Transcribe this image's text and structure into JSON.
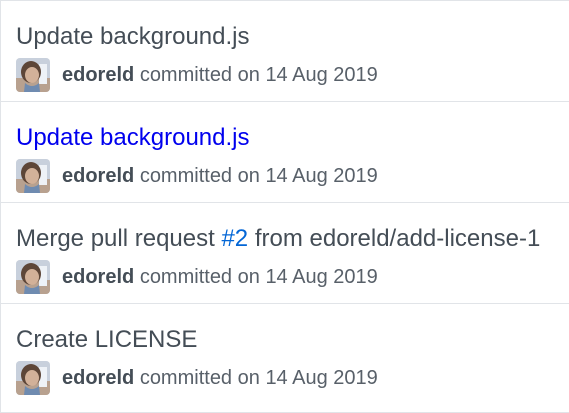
{
  "commits": [
    {
      "title": "Update background.js",
      "author": "edoreld",
      "action": "committed on",
      "date": "14 Aug 2019"
    },
    {
      "title": "Update background.js",
      "author": "edoreld",
      "action": "committed on",
      "date": "14 Aug 2019"
    },
    {
      "title_prefix": "Merge pull request",
      "pr_number": "#2",
      "title_suffix": "from edoreld/add-license-1",
      "author": "edoreld",
      "action": "committed on",
      "date": "14 Aug 2019"
    },
    {
      "title": "Create LICENSE",
      "author": "edoreld",
      "action": "committed on",
      "date": "14 Aug 2019"
    }
  ],
  "colors": {
    "title_default": "#444d56",
    "title_link": "#0000ee",
    "pr_link": "#0366d6",
    "meta_text": "#586069",
    "border": "#e1e4e8"
  },
  "icons": {
    "avatar": "user-avatar-photo"
  }
}
